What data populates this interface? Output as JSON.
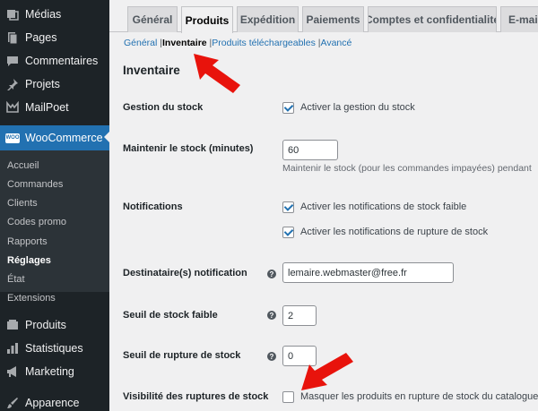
{
  "sidebar": {
    "items": [
      {
        "label": "Médias",
        "icon": "media-icon"
      },
      {
        "label": "Pages",
        "icon": "pages-icon"
      },
      {
        "label": "Commentaires",
        "icon": "comments-icon"
      },
      {
        "label": "Projets",
        "icon": "pin-icon"
      },
      {
        "label": "MailPoet",
        "icon": "mailpoet-icon"
      },
      {
        "label": "WooCommerce",
        "icon": "woocommerce-icon"
      },
      {
        "label": "Produits",
        "icon": "products-icon"
      },
      {
        "label": "Statistiques",
        "icon": "stats-icon"
      },
      {
        "label": "Marketing",
        "icon": "megaphone-icon"
      },
      {
        "label": "Apparence",
        "icon": "brush-icon"
      }
    ],
    "submenu": [
      "Accueil",
      "Commandes",
      "Clients",
      "Codes promo",
      "Rapports",
      "Réglages",
      "État",
      "Extensions"
    ],
    "current_submenu": "Réglages",
    "woo_badge": "WOO"
  },
  "tabs": [
    "Général",
    "Produits",
    "Expédition",
    "Paiements",
    "Comptes et confidentialité",
    "E-mail"
  ],
  "active_tab": "Produits",
  "subsections": {
    "general": "Général",
    "sep1": "|",
    "inventaire": "Inventaire",
    "sep2": "|",
    "telechargeables": "Produits téléchargeables",
    "sep3": "|",
    "avance": "Avancé"
  },
  "section_title": "Inventaire",
  "fields": {
    "gestion_stock": {
      "label": "Gestion du stock",
      "checkbox_label": "Activer la gestion du stock",
      "checked": true
    },
    "maintenir_stock": {
      "label": "Maintenir le stock (minutes)",
      "value": "60",
      "description": "Maintenir le stock (pour les commandes impayées) pendant"
    },
    "notifications": {
      "label": "Notifications",
      "option1": "Activer les notifications de stock faible",
      "option2": "Activer les notifications de rupture de stock",
      "checked1": true,
      "checked2": true
    },
    "destinataire": {
      "label": "Destinataire(s) notification",
      "value": "lemaire.webmaster@free.fr"
    },
    "seuil_faible": {
      "label": "Seuil de stock faible",
      "value": "2"
    },
    "seuil_rupture": {
      "label": "Seuil de rupture de stock",
      "value": "0"
    },
    "visibilite": {
      "label": "Visibilité des ruptures de stock",
      "checkbox_label": "Masquer les produits en rupture de stock du catalogue",
      "checked": false
    }
  },
  "help_glyph": "?",
  "colors": {
    "accent": "#2271b1",
    "sidebar_bg": "#1d2327",
    "annotation_arrow": "#e8130c"
  }
}
